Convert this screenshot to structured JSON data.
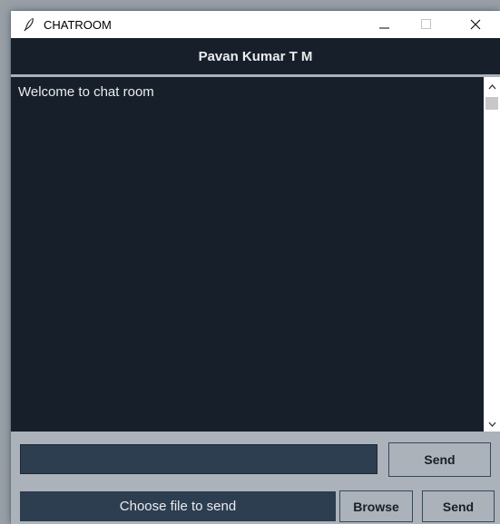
{
  "window": {
    "title": "CHATROOM",
    "icon": "feather-icon",
    "controls": [
      "minimize-icon",
      "maximize-icon",
      "close-icon"
    ]
  },
  "header": {
    "username": "Pavan Kumar T M"
  },
  "chat": {
    "messages": [
      "Welcome to chat room"
    ]
  },
  "message_input": {
    "value": "",
    "send_label": "Send"
  },
  "file": {
    "label": "Choose file to send",
    "browse_label": "Browse",
    "send_label": "Send"
  },
  "colors": {
    "dark_bg": "#17202a",
    "input_bg": "#2c3e50",
    "panel_gray": "#abb2b9",
    "text_light": "#eaecee"
  }
}
